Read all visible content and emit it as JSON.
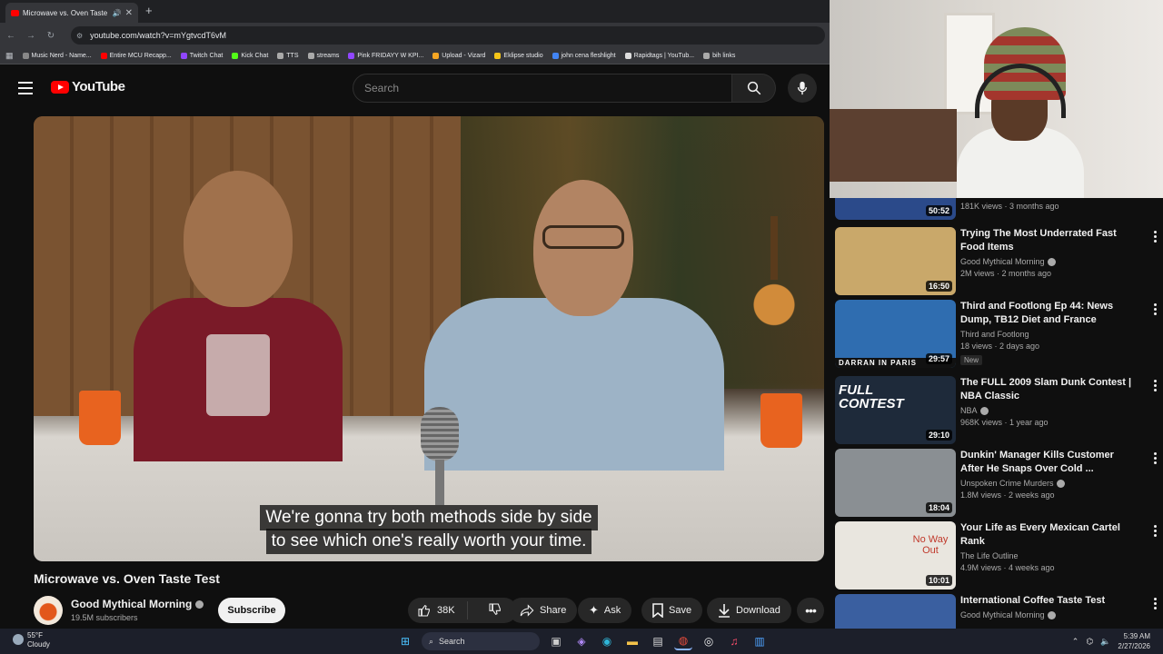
{
  "browser": {
    "tab_title": "Microwave vs. Oven Taste Te",
    "url": "youtube.com/watch?v=mYgtvcdT6vM",
    "bookmarks": [
      {
        "label": "Music Nerd - Name...",
        "color": "#888888"
      },
      {
        "label": "Entire MCU Recapp...",
        "color": "#ff0000"
      },
      {
        "label": "Twitch Chat",
        "color": "#9146ff"
      },
      {
        "label": "Kick Chat",
        "color": "#53fc18"
      },
      {
        "label": "TTS",
        "color": "#aaaaaa"
      },
      {
        "label": "streams",
        "color": "#aaaaaa"
      },
      {
        "label": "Pink FRIDAYY W KPI...",
        "color": "#9146ff"
      },
      {
        "label": "Upload - Vizard",
        "color": "#f5a623"
      },
      {
        "label": "Eklipse studio",
        "color": "#f5c518"
      },
      {
        "label": "john cena fleshlight",
        "color": "#4285f4"
      },
      {
        "label": "Rapidtags | YouTub...",
        "color": "#dddddd"
      },
      {
        "label": "bih links",
        "color": "#aaaaaa"
      }
    ]
  },
  "youtube": {
    "logo_text": "YouTube",
    "search_placeholder": "Search"
  },
  "video": {
    "subtitle_line1": "We're gonna try both methods side by side",
    "subtitle_line2": "to see which one's really worth your time.",
    "title": "Microwave vs. Oven Taste Test",
    "channel": "Good Mythical Morning",
    "subscribers": "19.5M subscribers",
    "subscribe_label": "Subscribe",
    "likes": "38K",
    "share_label": "Share",
    "ask_label": "Ask",
    "save_label": "Save",
    "download_label": "Download"
  },
  "sidebar": {
    "partial_top": {
      "meta": "181K views · 3 months ago",
      "duration": "50:52"
    },
    "items": [
      {
        "title": "Trying The Most Underrated Fast Food Items",
        "channel": "Good Mythical Morning",
        "verified": true,
        "meta": "2M views · 2 months ago",
        "duration": "16:50",
        "badge": "",
        "thumb_color": "#c9a86a"
      },
      {
        "title": "Third and Footlong Ep 44: News Dump, TB12 Diet and France",
        "channel": "Third and Footlong",
        "verified": false,
        "meta": "18 views · 2 days ago",
        "duration": "29:57",
        "badge": "New",
        "thumb_color": "#2f6db0"
      },
      {
        "title": "The FULL 2009 Slam Dunk Contest | NBA Classic",
        "channel": "NBA",
        "verified": true,
        "meta": "968K views · 1 year ago",
        "duration": "29:10",
        "badge": "",
        "thumb_color": "#1e2a3a"
      },
      {
        "title": "Dunkin' Manager Kills Customer After He Snaps Over Cold ...",
        "channel": "Unspoken Crime Murders",
        "verified": true,
        "meta": "1.8M views · 2 weeks ago",
        "duration": "18:04",
        "badge": "",
        "thumb_color": "#8a8f93"
      },
      {
        "title": "Your Life as Every Mexican Cartel Rank",
        "channel": "The Life Outline",
        "verified": false,
        "meta": "4.9M views · 4 weeks ago",
        "duration": "10:01",
        "badge": "",
        "thumb_color": "#e9e6df"
      },
      {
        "title": "International Coffee Taste Test",
        "channel": "Good Mythical Morning",
        "verified": true,
        "meta": "",
        "duration": "",
        "badge": "",
        "thumb_color": "#3a5fa0"
      }
    ],
    "thumb_text": {
      "nba_text": "FULL CONTEST",
      "tf_text": "DARRAN IN PARIS",
      "cartel_text": "No Way Out"
    }
  },
  "taskbar": {
    "temp": "55°F",
    "condition": "Cloudy",
    "search_label": "Search",
    "time": "5:39 AM",
    "date": "2/27/2026"
  }
}
